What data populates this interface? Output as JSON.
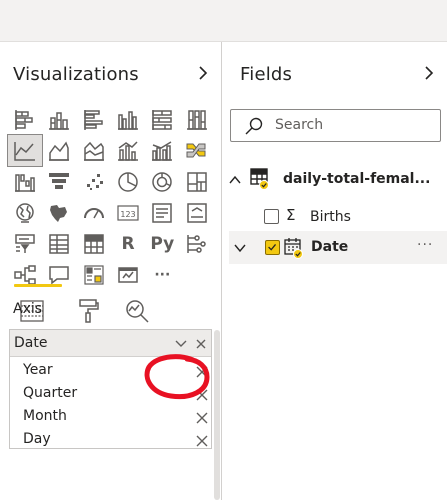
{
  "visualizations": {
    "title": "Visualizations",
    "gallery": [
      [
        "stacked-bar-chart-icon",
        "stacked-column-chart-icon",
        "clustered-bar-chart-icon",
        "clustered-column-chart-icon",
        "100-stacked-bar-chart-icon",
        "100-stacked-column-chart-icon"
      ],
      [
        "line-chart-icon",
        "area-chart-icon",
        "stacked-area-chart-icon",
        "line-and-column-chart-icon",
        "line-and-clustered-column-chart-icon",
        "ribbon-chart-icon"
      ],
      [
        "waterfall-chart-icon",
        "funnel-chart-icon",
        "scatter-chart-icon",
        "pie-chart-icon",
        "donut-chart-icon",
        "treemap-icon"
      ],
      [
        "map-icon",
        "filled-map-icon",
        "gauge-icon",
        "card-icon",
        "multi-row-card-icon",
        "kpi-icon"
      ],
      [
        "slicer-icon",
        "table-icon",
        "matrix-icon",
        "r-visual-icon",
        "python-visual-icon",
        "key-influencers-icon"
      ],
      [
        "decomposition-tree-icon",
        "qa-icon",
        "smart-narrative-icon",
        "paginated-report-icon",
        "more-visuals-icon"
      ]
    ],
    "gallery_text": {
      "r": "R",
      "py": "Py",
      "more": "···",
      "card": "123"
    },
    "selected_visual": "line-chart-icon",
    "tabs": [
      "fields-tab-icon",
      "format-paint-roller-icon",
      "analytics-magnifier-icon"
    ],
    "active_tab": "fields-tab-icon",
    "axis": {
      "label": "Axis",
      "field": "Date",
      "hierarchy": [
        "Year",
        "Quarter",
        "Month",
        "Day"
      ]
    }
  },
  "fields": {
    "title": "Fields",
    "search_placeholder": "Search",
    "table_name": "daily-total-femal...",
    "items": [
      {
        "label": "Births",
        "icon": "sigma-icon",
        "sigma": "Σ",
        "checked": false
      },
      {
        "label": "Date",
        "icon": "calendar-hierarchy-icon",
        "checked": true,
        "more": "···"
      }
    ]
  },
  "colors": {
    "accent_yellow": "#f2c811",
    "annotation_red": "#e81123",
    "pane_border": "#d2d0ce",
    "icon_gray": "#605e5c"
  }
}
